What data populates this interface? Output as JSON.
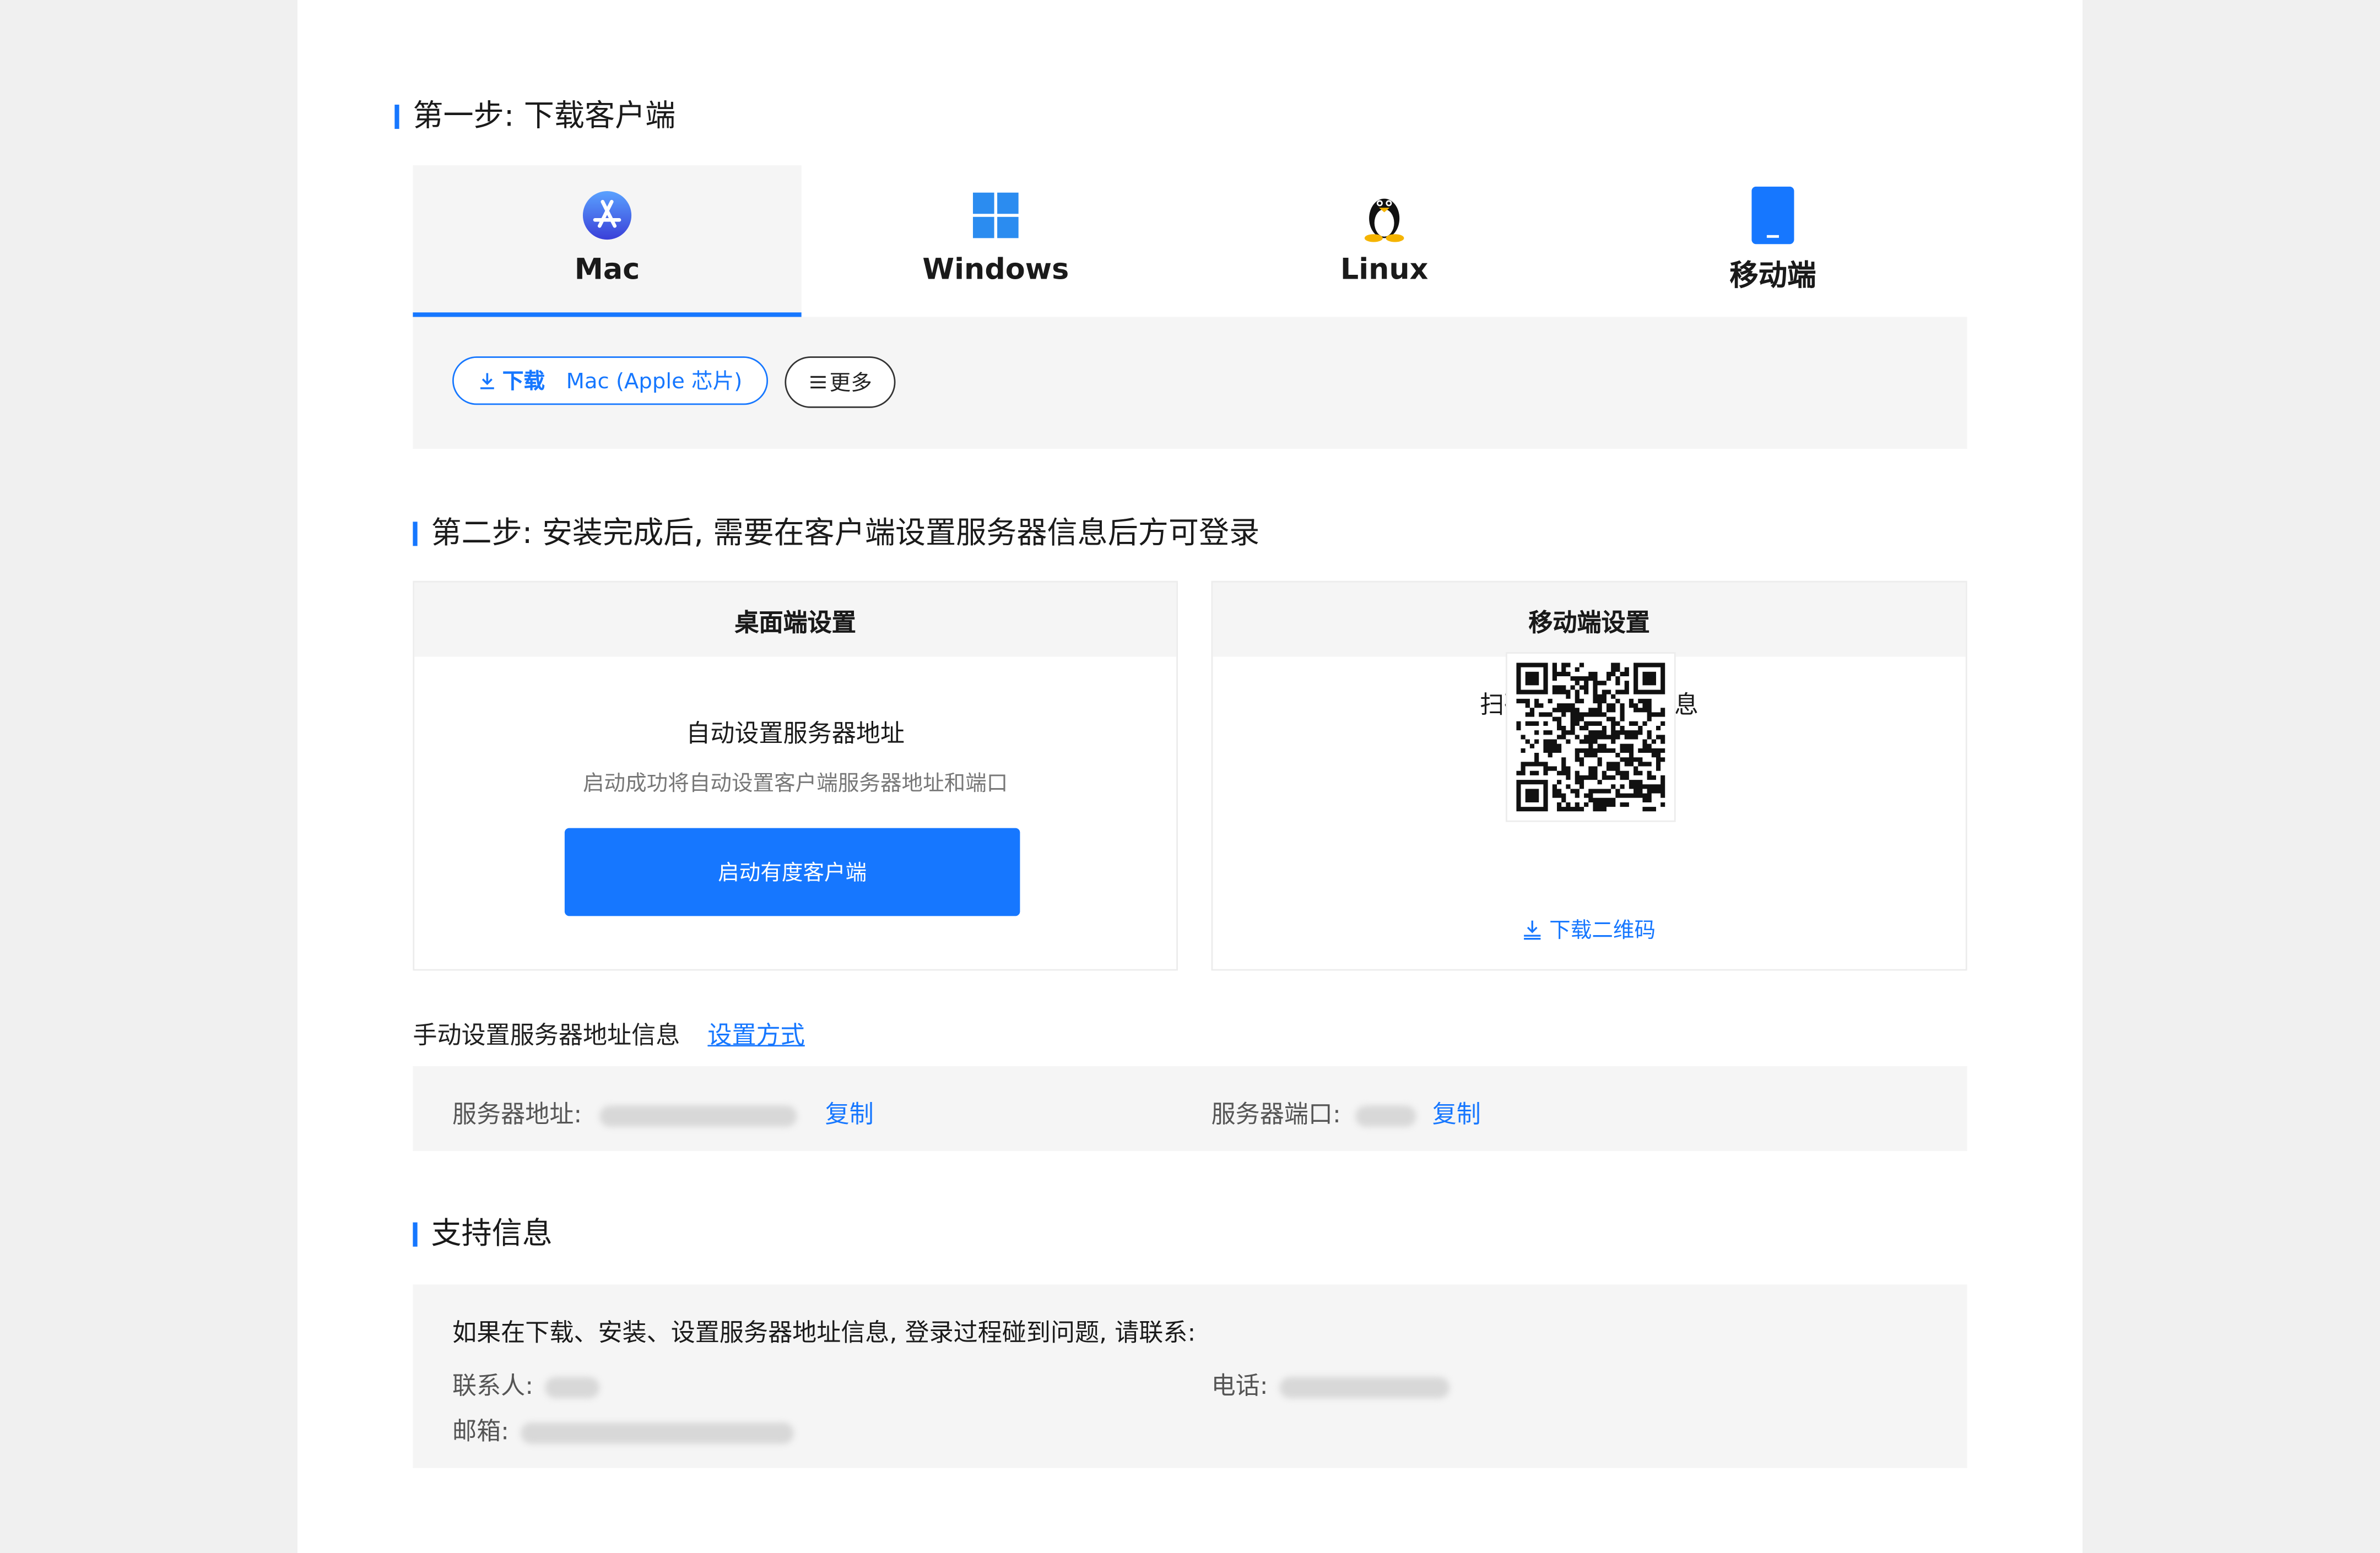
{
  "step1": {
    "title": "第一步: 下载客户端"
  },
  "tabs": [
    {
      "label": "Mac",
      "icon": "app-store-icon",
      "active": true
    },
    {
      "label": "Windows",
      "icon": "windows-logo-icon",
      "active": false
    },
    {
      "label": "Linux",
      "icon": "linux-penguin-icon",
      "active": false
    },
    {
      "label": "移动端",
      "icon": "mobile-phone-icon",
      "active": false
    }
  ],
  "download": {
    "button_prefix": "下载",
    "button_label": "Mac (Apple 芯片)",
    "more_label": "更多"
  },
  "step2": {
    "title": "第二步: 安装完成后, 需要在客户端设置服务器信息后方可登录",
    "desktop": {
      "header": "桌面端设置",
      "heading": "自动设置服务器地址",
      "description": "启动成功将自动设置客户端服务器地址和端口",
      "launch_button": "启动有度客户端"
    },
    "mobile": {
      "header": "移动端设置",
      "heading": "扫码设置服务器信息",
      "download_qr": "下载二维码"
    },
    "manual": {
      "label": "手动设置服务器地址信息",
      "link": "设置方式",
      "server_address_label": "服务器地址:",
      "server_port_label": "服务器端口:",
      "copy_label": "复制"
    }
  },
  "support": {
    "title": "支持信息",
    "message": "如果在下载、安装、设置服务器地址信息, 登录过程碰到问题, 请联系:",
    "contact_label": "联系人:",
    "phone_label": "电话:",
    "email_label": "邮箱:"
  },
  "colors": {
    "accent": "#1677ff",
    "panel_bg": "#f5f5f5",
    "page_bg": "#f0f0f0"
  }
}
